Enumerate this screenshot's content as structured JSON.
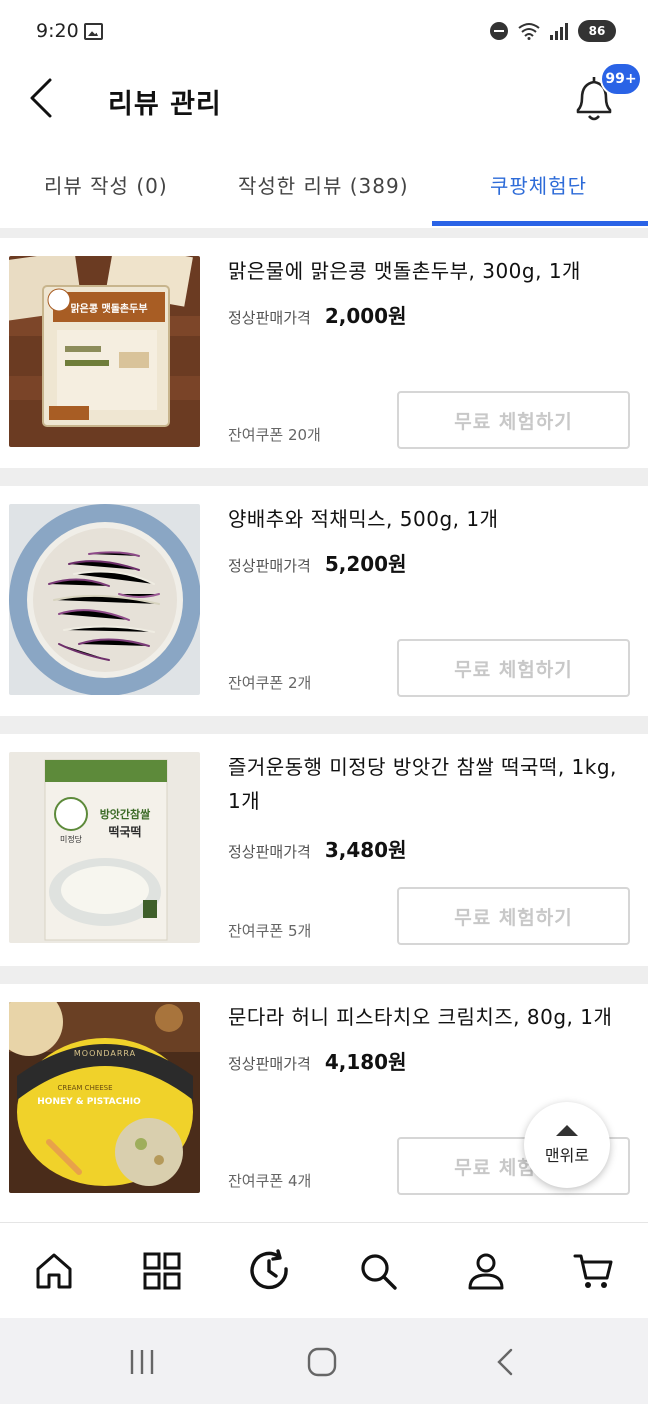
{
  "status": {
    "time": "9:20",
    "battery": "86"
  },
  "header": {
    "title": "리뷰 관리",
    "badge": "99+"
  },
  "tabs": [
    {
      "label": "리뷰 작성 (0)"
    },
    {
      "label": "작성한 리뷰 (389)"
    },
    {
      "label": "쿠팡체험단"
    }
  ],
  "products": [
    {
      "name": "맑은물에 맑은콩 맷돌촌두부, 300g, 1개",
      "price_label": "정상판매가격",
      "price": "2,000원",
      "coupon": "잔여쿠폰 20개",
      "button": "무료 체험하기"
    },
    {
      "name": "양배추와 적채믹스, 500g, 1개",
      "price_label": "정상판매가격",
      "price": "5,200원",
      "coupon": "잔여쿠폰 2개",
      "button": "무료 체험하기"
    },
    {
      "name": "즐거운동행 미정당 방앗간 참쌀 떡국떡, 1kg, 1개",
      "price_label": "정상판매가격",
      "price": "3,480원",
      "coupon": "잔여쿠폰 5개",
      "button": "무료 체험하기"
    },
    {
      "name": "문다라 허니 피스타치오 크림치즈, 80g, 1개",
      "price_label": "정상판매가격",
      "price": "4,180원",
      "coupon": "잔여쿠폰 4개",
      "button": "무료 체험하기"
    }
  ],
  "image_text": {
    "tofu": "맑은콩 맷돌촌두부",
    "rice_cake_brand": "미정당",
    "rice_cake_title": "방앗간참쌀",
    "rice_cake_sub": "떡국떡",
    "cheese_brand": "MOONDARRA",
    "cheese_line1": "CREAM CHEESE",
    "cheese_line2": "HONEY & PISTACHIO"
  },
  "scroll_top": {
    "label": "맨위로"
  },
  "bottom_nav": [
    "home-icon",
    "category-icon",
    "recent-icon",
    "search-icon",
    "my-page-icon",
    "cart-icon"
  ],
  "colors": {
    "accent": "#2a63e6",
    "divider": "#eeeeee",
    "disabled_text": "#c8c8c8"
  }
}
